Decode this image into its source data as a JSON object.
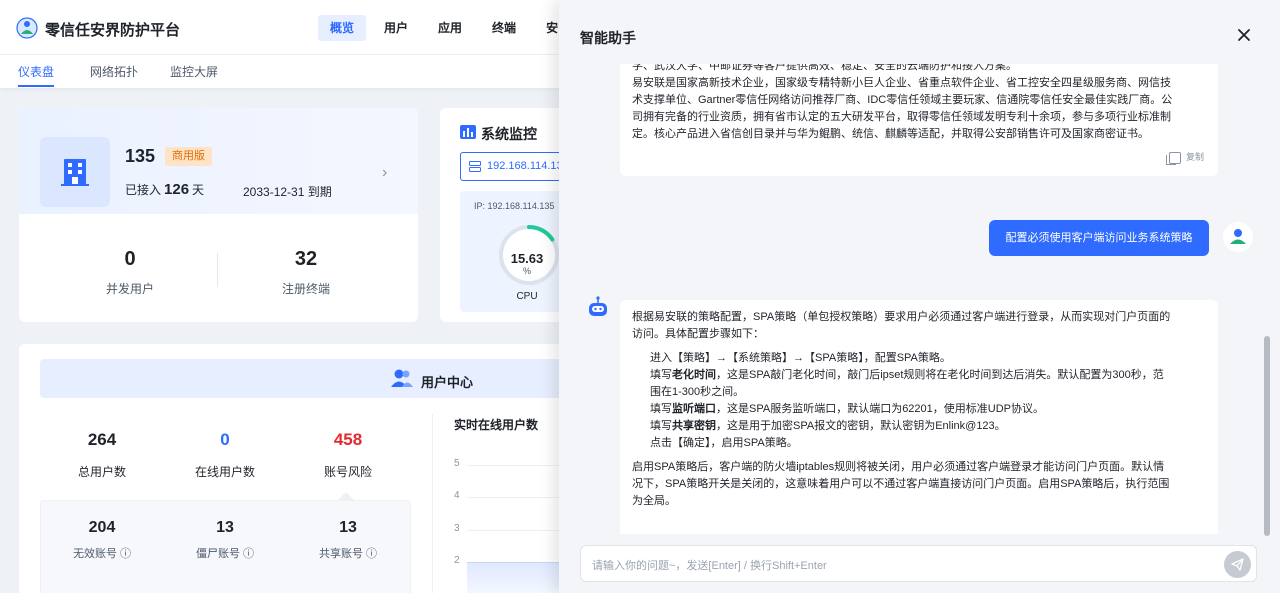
{
  "app": {
    "brand": "零信任安界防护平台",
    "nav": [
      "概览",
      "用户",
      "应用",
      "终端",
      "安"
    ],
    "nav_active": "概览",
    "subnav": [
      "仪表盘",
      "网络拓扑",
      "监控大屏"
    ],
    "subnav_active": "仪表盘"
  },
  "license": {
    "count": "135",
    "edition": "商用版",
    "days_prefix": "已接入",
    "days": "126",
    "days_unit": "天",
    "expire": "2033-12-31 到期",
    "concurrent_value": "0",
    "concurrent_label": "并发用户",
    "terminals_value": "32",
    "terminals_label": "注册终端"
  },
  "monitor": {
    "title": "系统监控",
    "ip_select": "192.168.114.13",
    "ip_line": "IP: 192.168.114.135",
    "cpu_value": "15.63",
    "cpu_unit": "%",
    "cpu_label": "CPU",
    "cpu_percent": 15.63
  },
  "user_center": {
    "title": "用户中心",
    "total_value": "264",
    "total_label": "总用户数",
    "online_value": "0",
    "online_label": "在线用户数",
    "risk_value": "458",
    "risk_label": "账号风险",
    "invalid_value": "204",
    "invalid_label": "无效账号 ⓘ",
    "zombie_value": "13",
    "zombie_label": "僵尸账号 ⓘ",
    "shared_value": "13",
    "shared_label": "共享账号 ⓘ",
    "online_chart_title": "实时在线用户数",
    "y_ticks": [
      "5",
      "4",
      "3",
      "2"
    ]
  },
  "assistant": {
    "title": "智能助手",
    "msg1_lines": [
      "学、武汉大学、中邮证券等客户提供高效、稳定、安全的云端防护和接入方案。",
      "易安联是国家高新技术企业，国家级专精特新小巨人企业、省重点软件企业、省工控安全四星级服务商、网信技",
      "术支撑单位、Gartner零信任网络访问推荐厂商、IDC零信任领域主要玩家、信通院零信任安全最佳实践厂商。公",
      "司拥有完备的行业资质，拥有省市认定的五大研发平台，取得零信任领域发明专利十余项，参与多项行业标准制",
      "定。核心产品进入省信创目录并与华为鲲鹏、统信、麒麟等适配，并取得公安部销售许可及国家商密证书。"
    ],
    "copy_label": "复制",
    "user_msg": "配置必须使用客户端访问业务系统策略",
    "msg2": {
      "intro": "根据易安联的策略配置，SPA策略（单包授权策略）要求用户必须通过客户端进行登录，从而实现对门户页面的",
      "intro2": "访问。具体配置步骤如下：",
      "step1": "进入【策略】→【系统策略】→【SPA策略】，配置SPA策略。",
      "step2_a": "填写",
      "step2_b": "老化时间",
      "step2_c": "，这是SPA敲门老化时间，敲门后ipset规则将在老化时间到达后消失。默认配置为300秒，范",
      "step2_d": "围在1-300秒之间。",
      "step3_a": "填写",
      "step3_b": "监听端口",
      "step3_c": "，这是SPA服务监听端口，默认端口为62201，使用标准UDP协议。",
      "step4_a": "填写",
      "step4_b": "共享密钥",
      "step4_c": "，这是用于加密SPA报文的密钥，默认密钥为Enlink@123。",
      "step5": "点击【确定】，启用SPA策略。",
      "outro1": "启用SPA策略后，客户端的防火墙iptables规则将被关闭，用户必须通过客户端登录才能访问门户页面。默认情",
      "outro2": "况下，SPA策略开关是关闭的，这意味着用户可以不通过客户端直接访问门户页面。启用SPA策略后，执行范围",
      "outro3": "为全局。"
    },
    "input_placeholder": "请输入你的问题~，发送[Enter] / 换行Shift+Enter"
  },
  "colors": {
    "accent": "#2f6bff",
    "risk": "#e5282f",
    "tag_bg": "#ffe3c7",
    "tag_text": "#e36d00"
  }
}
